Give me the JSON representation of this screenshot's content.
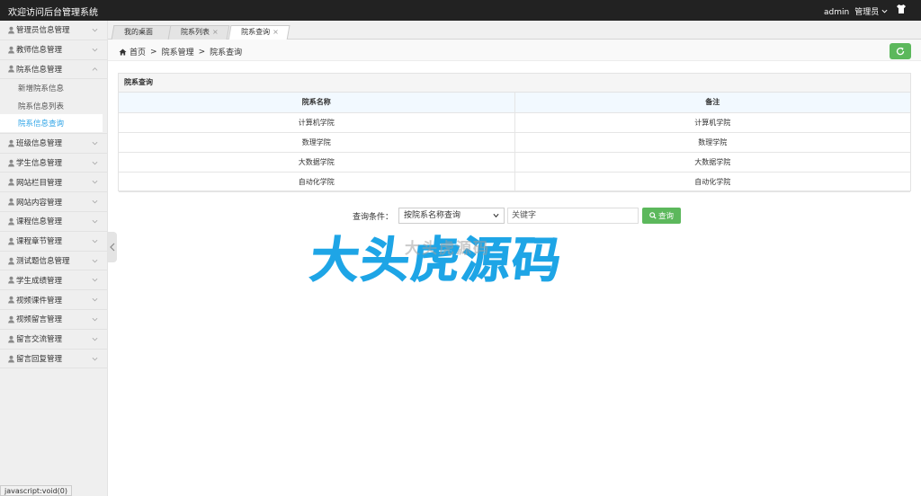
{
  "header": {
    "title": "欢迎访问后台管理系统",
    "user": "admin",
    "role": "管理员"
  },
  "sidebar": {
    "items": [
      {
        "label": "管理员信息管理"
      },
      {
        "label": "教师信息管理"
      },
      {
        "label": "院系信息管理",
        "expanded": true,
        "children": [
          {
            "label": "新增院系信息"
          },
          {
            "label": "院系信息列表"
          },
          {
            "label": "院系信息查询",
            "active": true
          }
        ]
      },
      {
        "label": "班级信息管理"
      },
      {
        "label": "学生信息管理"
      },
      {
        "label": "网站栏目管理"
      },
      {
        "label": "网站内容管理"
      },
      {
        "label": "课程信息管理"
      },
      {
        "label": "课程章节管理"
      },
      {
        "label": "测试题信息管理"
      },
      {
        "label": "学生成绩管理"
      },
      {
        "label": "视频课件管理"
      },
      {
        "label": "视频留言管理"
      },
      {
        "label": "留言交流管理"
      },
      {
        "label": "留言回复管理"
      }
    ]
  },
  "tabs": [
    {
      "label": "我的桌面"
    },
    {
      "label": "院系列表"
    },
    {
      "label": "院系查询",
      "active": true
    }
  ],
  "breadcrumb": {
    "home": "首页",
    "level1": "院系管理",
    "level2": "院系查询"
  },
  "panel": {
    "title": "院系查询",
    "columns": [
      "院系名称",
      "备注"
    ],
    "rows": [
      [
        "计算机学院",
        "计算机学院"
      ],
      [
        "数理学院",
        "数理学院"
      ],
      [
        "大数据学院",
        "大数据学院"
      ],
      [
        "自动化学院",
        "自动化学院"
      ]
    ]
  },
  "query": {
    "label": "查询条件：",
    "select_value": "按院系名称查询",
    "keyword_placeholder": "关键字",
    "button": "查询"
  },
  "watermark": {
    "big": "大头虎源码",
    "small": "大头虎源码"
  },
  "statusbar": "javascript:void(0)",
  "colors": {
    "accent": "#2fa4e7",
    "success": "#5cb85c",
    "header": "#222222",
    "watermark": "#1ea5e6"
  }
}
